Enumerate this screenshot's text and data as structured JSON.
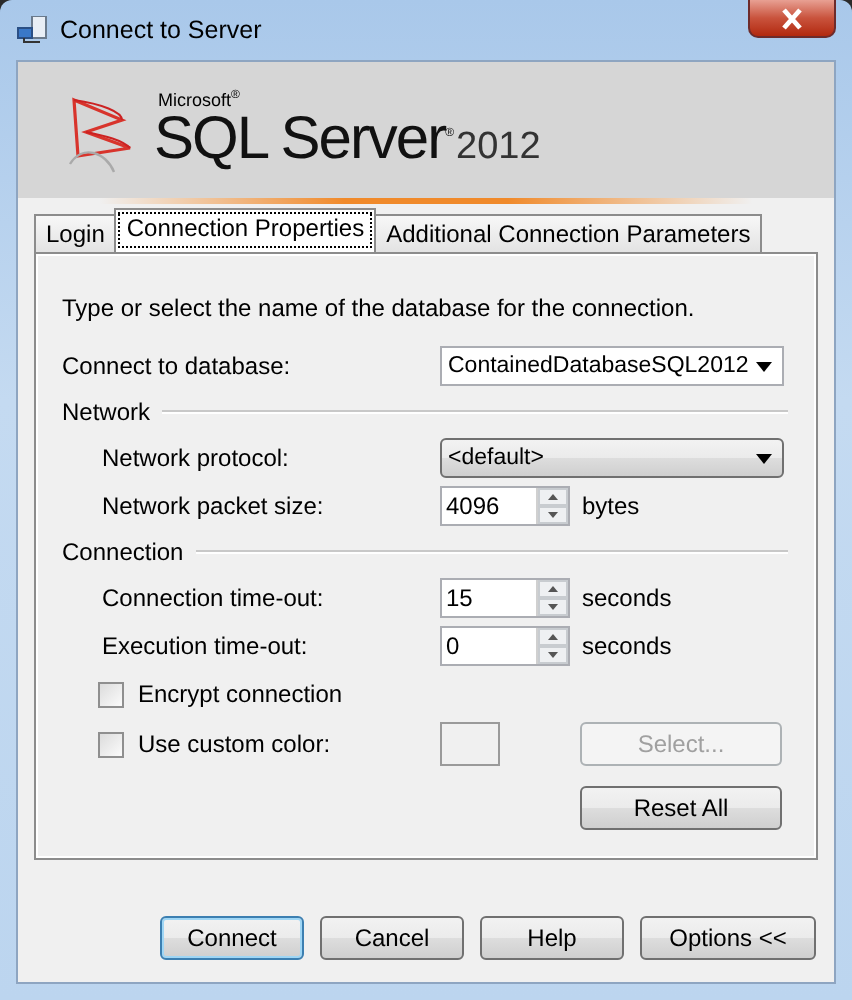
{
  "window": {
    "title": "Connect to Server"
  },
  "banner": {
    "vendor": "Microsoft$^{®}$",
    "product": "SQL Server$^{®}$",
    "version": "2012"
  },
  "tabs": [
    {
      "label": "Login",
      "selected": false
    },
    {
      "label": "Connection Properties",
      "selected": true
    },
    {
      "label": "Additional Connection Parameters",
      "selected": false
    }
  ],
  "description": "Type or select the name of the database for the connection.",
  "rows": [
    {
      "kind": "combo",
      "label": "Connect to database:",
      "value": "ContainedDatabaseSQL2012"
    },
    {
      "kind": "section",
      "label": "Network",
      "children": [
        {
          "kind": "dropdown",
          "label": "Network protocol:",
          "value": "<default>"
        },
        {
          "kind": "spin",
          "label": "Network packet size:",
          "value": "4096",
          "unit": "bytes"
        }
      ]
    },
    {
      "kind": "section",
      "label": "Connection",
      "children": [
        {
          "kind": "spin",
          "label": "Connection time-out:",
          "value": "15",
          "unit": "seconds"
        },
        {
          "kind": "spin",
          "label": "Execution time-out:",
          "value": "0",
          "unit": "seconds"
        },
        {
          "kind": "checkbox",
          "label": "Encrypt connection",
          "checked": false
        },
        {
          "kind": "color",
          "label": "Use custom color:",
          "checked": false,
          "button": {
            "label": "Select...",
            "disabled": true
          }
        }
      ]
    }
  ],
  "reset_button": {
    "label": "Reset All",
    "disabled": false
  },
  "buttons": [
    {
      "label": "Connect",
      "default": true
    },
    {
      "label": "Cancel",
      "default": false
    },
    {
      "label": "Help",
      "default": false
    },
    {
      "label": "Options <<",
      "default": false
    }
  ]
}
